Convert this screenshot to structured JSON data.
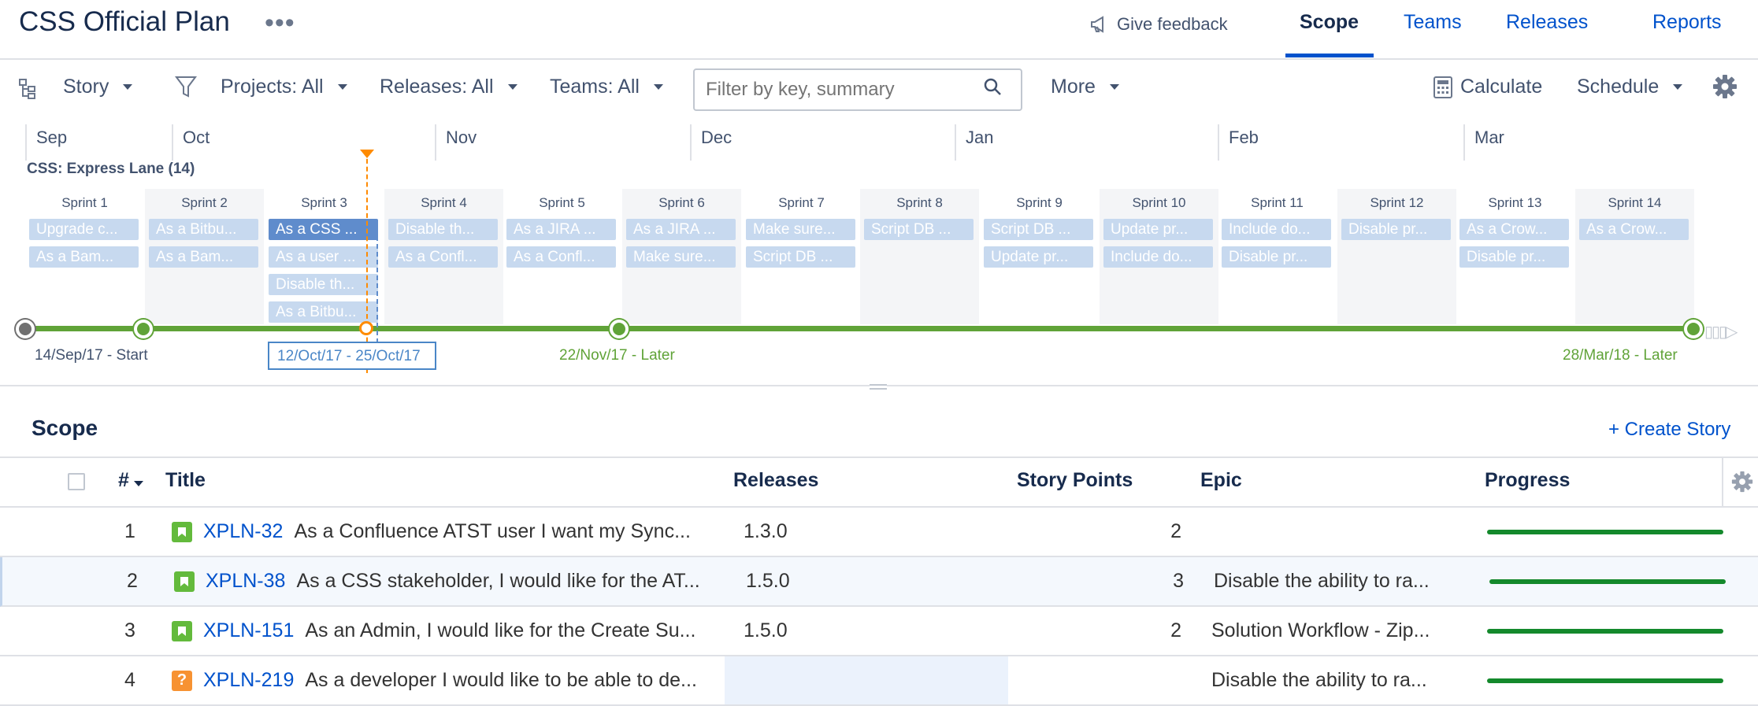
{
  "header": {
    "title": "CSS Official Plan",
    "more_dots": "•••",
    "feedback": "Give feedback",
    "tabs": [
      "Scope",
      "Teams",
      "Releases",
      "Reports"
    ]
  },
  "toolbar": {
    "view": "Story",
    "projects": "Projects: All",
    "releases": "Releases: All",
    "teams": "Teams: All",
    "search_placeholder": "Filter by key, summary",
    "more": "More",
    "calculate": "Calculate",
    "schedule": "Schedule"
  },
  "months": [
    "Sep",
    "Oct",
    "Nov",
    "Dec",
    "Jan",
    "Feb",
    "Mar"
  ],
  "lane": "CSS: Express Lane (14)",
  "sprints": [
    {
      "name": "Sprint 1",
      "items": [
        "Upgrade c...",
        "As a Bam..."
      ]
    },
    {
      "name": "Sprint 2",
      "items": [
        "As a Bitbu...",
        "As a Bam..."
      ]
    },
    {
      "name": "Sprint 3",
      "items": [
        "As a CSS ...",
        "As a user ...",
        "Disable th...",
        "As a Bitbu..."
      ]
    },
    {
      "name": "Sprint 4",
      "items": [
        "Disable th...",
        "As a Confl..."
      ]
    },
    {
      "name": "Sprint 5",
      "items": [
        "As a JIRA ...",
        "As a Confl..."
      ]
    },
    {
      "name": "Sprint 6",
      "items": [
        "As a JIRA ...",
        "Make sure..."
      ]
    },
    {
      "name": "Sprint 7",
      "items": [
        "Make sure...",
        "Script DB ..."
      ]
    },
    {
      "name": "Sprint 8",
      "items": [
        "Script DB ..."
      ]
    },
    {
      "name": "Sprint 9",
      "items": [
        "Script DB ...",
        "Update pr..."
      ]
    },
    {
      "name": "Sprint 10",
      "items": [
        "Update pr...",
        "Include do..."
      ]
    },
    {
      "name": "Sprint 11",
      "items": [
        "Include do...",
        "Disable pr..."
      ]
    },
    {
      "name": "Sprint 12",
      "items": [
        "Disable pr..."
      ]
    },
    {
      "name": "Sprint 13",
      "items": [
        "As a Crow...",
        "Disable pr..."
      ]
    },
    {
      "name": "Sprint 14",
      "items": [
        "As a Crow..."
      ]
    }
  ],
  "timeline": {
    "start_label": "14/Sep/17 - Start",
    "selected_range": "12/Oct/17 - 25/Oct/17",
    "mid_label": "22/Nov/17 - Later",
    "end_label": "28/Mar/18 - Later"
  },
  "scope": {
    "heading": "Scope",
    "create_label": "+ Create Story",
    "columns": [
      "#",
      "Title",
      "Releases",
      "Story Points",
      "Epic",
      "Progress"
    ],
    "rows": [
      {
        "num": "1",
        "type": "story",
        "key": "XPLN-32",
        "title": "As a Confluence ATST user I want my Sync...",
        "release": "1.3.0",
        "points": "2",
        "epic": "",
        "progress": 1.0
      },
      {
        "num": "2",
        "type": "story",
        "key": "XPLN-38",
        "title": "As a CSS stakeholder, I would like for the AT...",
        "release": "1.5.0",
        "points": "3",
        "epic": "Disable the ability to ra...",
        "progress": 1.0
      },
      {
        "num": "3",
        "type": "story",
        "key": "XPLN-151",
        "title": "As an Admin, I would like for the Create Su...",
        "release": "1.5.0",
        "points": "2",
        "epic": "Solution Workflow - Zip...",
        "progress": 1.0
      },
      {
        "num": "4",
        "type": "question",
        "key": "XPLN-219",
        "title": "As a developer I would like to be able to de...",
        "release": "",
        "points": "",
        "epic": "Disable the ability to ra...",
        "progress": 1.0
      }
    ]
  },
  "colors": {
    "accent": "#0052cc",
    "timeline_green": "#60a338",
    "today_orange": "#ff8b00",
    "chip": "#c7d9ef",
    "chip_selected": "#5f8ccc",
    "progress_green": "#14892c"
  }
}
